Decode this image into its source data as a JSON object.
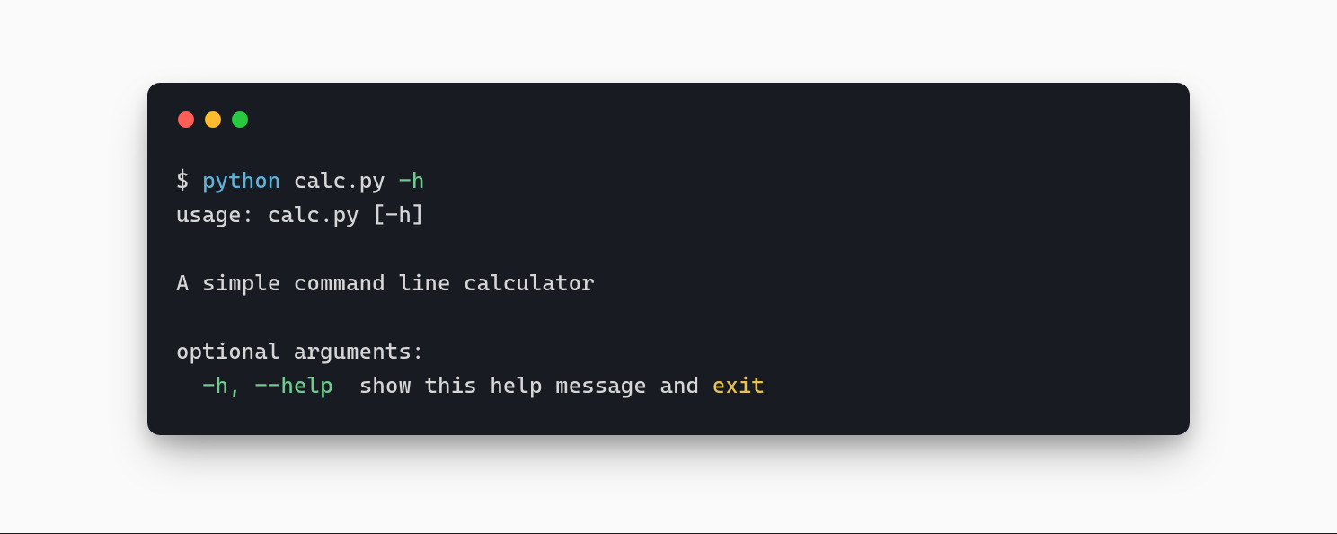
{
  "terminal": {
    "traffic_lights": {
      "red": "#ff5f57",
      "yellow": "#febc2e",
      "green": "#28c840"
    },
    "prompt": "$ ",
    "command": {
      "interpreter": "python",
      "script": " calc.py ",
      "flag": "-h"
    },
    "output": {
      "usage": "usage: calc.py [-h]",
      "blank1": "",
      "description": "A simple command line calculator",
      "blank2": "",
      "optional_header": "optional arguments:",
      "help_line": {
        "indent": "  ",
        "flags": "-h, --help",
        "spacing": "  ",
        "before_exit": "show this help message and ",
        "exit": "exit"
      }
    }
  }
}
